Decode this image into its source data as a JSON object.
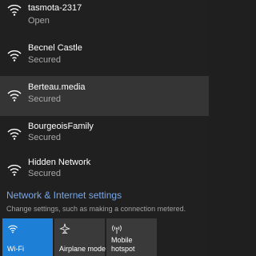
{
  "networks": [
    {
      "name": "tasmota-2317",
      "status": "Open"
    },
    {
      "name": "Becnel  Castle",
      "status": "Secured"
    },
    {
      "name": "Berteau.media",
      "status": "Secured"
    },
    {
      "name": "BourgeoisFamily",
      "status": "Secured"
    },
    {
      "name": "Hidden Network",
      "status": "Secured"
    }
  ],
  "settings": {
    "link": "Network & Internet settings",
    "description": "Change settings, such as making a connection metered."
  },
  "quick_actions": [
    {
      "label": "Wi-Fi",
      "icon": "wifi-icon",
      "state": "on"
    },
    {
      "label": "Airplane mode",
      "icon": "airplane-icon",
      "state": "off"
    },
    {
      "label_line1": "Mobile",
      "label_line2": "hotspot",
      "icon": "hotspot-icon",
      "state": "off"
    }
  ],
  "colors": {
    "accent": "#1e7fd6",
    "link": "#7aa7e6",
    "panel": "#202020",
    "selected": "#353535"
  }
}
